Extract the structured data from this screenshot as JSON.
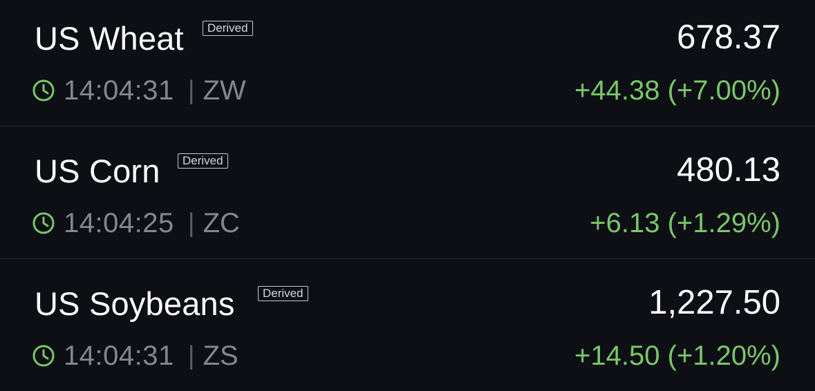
{
  "colors": {
    "background": "#0e0f14",
    "text_primary": "#ffffff",
    "text_secondary": "#85878e",
    "positive": "#78c86a",
    "divider": "#24262e"
  },
  "rows": [
    {
      "name": "US Wheat",
      "badge": "Derived",
      "price": "678.37",
      "time": "14:04:31",
      "separator": "|",
      "symbol": "ZW",
      "change": "+44.38 (+7.00%)",
      "icon": "clock-icon"
    },
    {
      "name": "US Corn",
      "badge": "Derived",
      "price": "480.13",
      "time": "14:04:25",
      "separator": "|",
      "symbol": "ZC",
      "change": "+6.13 (+1.29%)",
      "icon": "clock-icon"
    },
    {
      "name": "US Soybeans",
      "badge": "Derived",
      "price": "1,227.50",
      "time": "14:04:31",
      "separator": "|",
      "symbol": "ZS",
      "change": "+14.50 (+1.20%)",
      "icon": "clock-icon"
    }
  ]
}
